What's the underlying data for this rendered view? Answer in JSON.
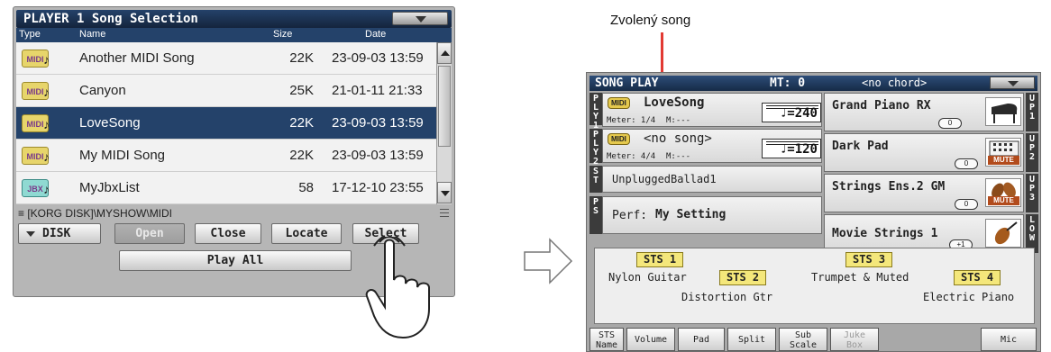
{
  "left_window": {
    "title": "PLAYER 1 Song Selection",
    "columns": {
      "type": "Type",
      "name": "Name",
      "size": "Size",
      "date": "Date"
    },
    "rows": [
      {
        "type_icon": "MIDI",
        "name": "Another MIDI Song",
        "size": "22K",
        "date": "23-09-03 13:59",
        "selected": false
      },
      {
        "type_icon": "MIDI",
        "name": "Canyon",
        "size": "25K",
        "date": "21-01-11 21:33",
        "selected": false
      },
      {
        "type_icon": "MIDI",
        "name": "LoveSong",
        "size": "22K",
        "date": "23-09-03 13:59",
        "selected": true
      },
      {
        "type_icon": "MIDI",
        "name": "My MIDI Song",
        "size": "22K",
        "date": "23-09-03 13:59",
        "selected": false
      },
      {
        "type_icon": "JBX",
        "name": "MyJbxList",
        "size": "58",
        "date": "17-12-10 23:55",
        "selected": false
      }
    ],
    "path": "[KORG DISK]\\MYSHOW\\MIDI",
    "buttons": {
      "disk": "DISK",
      "open": "Open",
      "close": "Close",
      "locate": "Locate",
      "select": "Select",
      "play_all": "Play All"
    }
  },
  "caption": "Zvolený song",
  "right_window": {
    "title": "SONG PLAY",
    "mt": "MT: 0",
    "chord": "<no chord>",
    "ply1": {
      "label": "PLY1",
      "badge": "MIDI",
      "song": "LoveSong",
      "meter": "Meter: 1/4",
      "measure": "M:---",
      "tempo": "♩=240"
    },
    "ply2": {
      "label": "PLY2",
      "badge": "MIDI",
      "song": "<no song>",
      "meter": "Meter: 4/4",
      "measure": "M:---",
      "tempo": "♩=120"
    },
    "st": {
      "label": "ST",
      "text": "UnpluggedBallad1"
    },
    "ps": {
      "label": "PS",
      "text_prefix": "Perf: ",
      "text": "My Setting"
    },
    "sounds": [
      {
        "name": "Grand Piano RX",
        "octave": "0",
        "side": "UP1",
        "icon": "grand-piano-icon",
        "muted": false
      },
      {
        "name": "Dark Pad",
        "octave": "0",
        "side": "UP2",
        "icon": "keyboard-icon",
        "muted": true
      },
      {
        "name": "Strings Ens.2 GM",
        "octave": "0",
        "side": "UP3",
        "icon": "violins-icon",
        "muted": true
      },
      {
        "name": "Movie Strings 1",
        "octave": "+1",
        "side": "LOW",
        "icon": "violin-icon",
        "muted": false
      }
    ],
    "mute_label": "MUTE",
    "sts": {
      "b1": "STS 1",
      "b2": "STS 2",
      "b3": "STS 3",
      "b4": "STS 4",
      "t1": "Nylon Guitar",
      "t2": "Distortion Gtr",
      "t3": "Trumpet & Muted",
      "t4": "Electric Piano"
    },
    "tabs": [
      {
        "l1": "STS",
        "l2": "Name"
      },
      {
        "l1": "Volume"
      },
      {
        "l1": "Pad"
      },
      {
        "l1": "Split"
      },
      {
        "l1": "Sub",
        "l2": "Scale"
      },
      {
        "l1": "Juke",
        "l2": "Box"
      },
      {
        "l1": "Mic"
      }
    ]
  },
  "colors": {
    "title_bar": "#24426a",
    "selection": "#24426a",
    "midi_badge": "#e7d56b",
    "sts_badge": "#f4e77b",
    "mute": "#b24b1c",
    "pointer": "#e23a33"
  }
}
